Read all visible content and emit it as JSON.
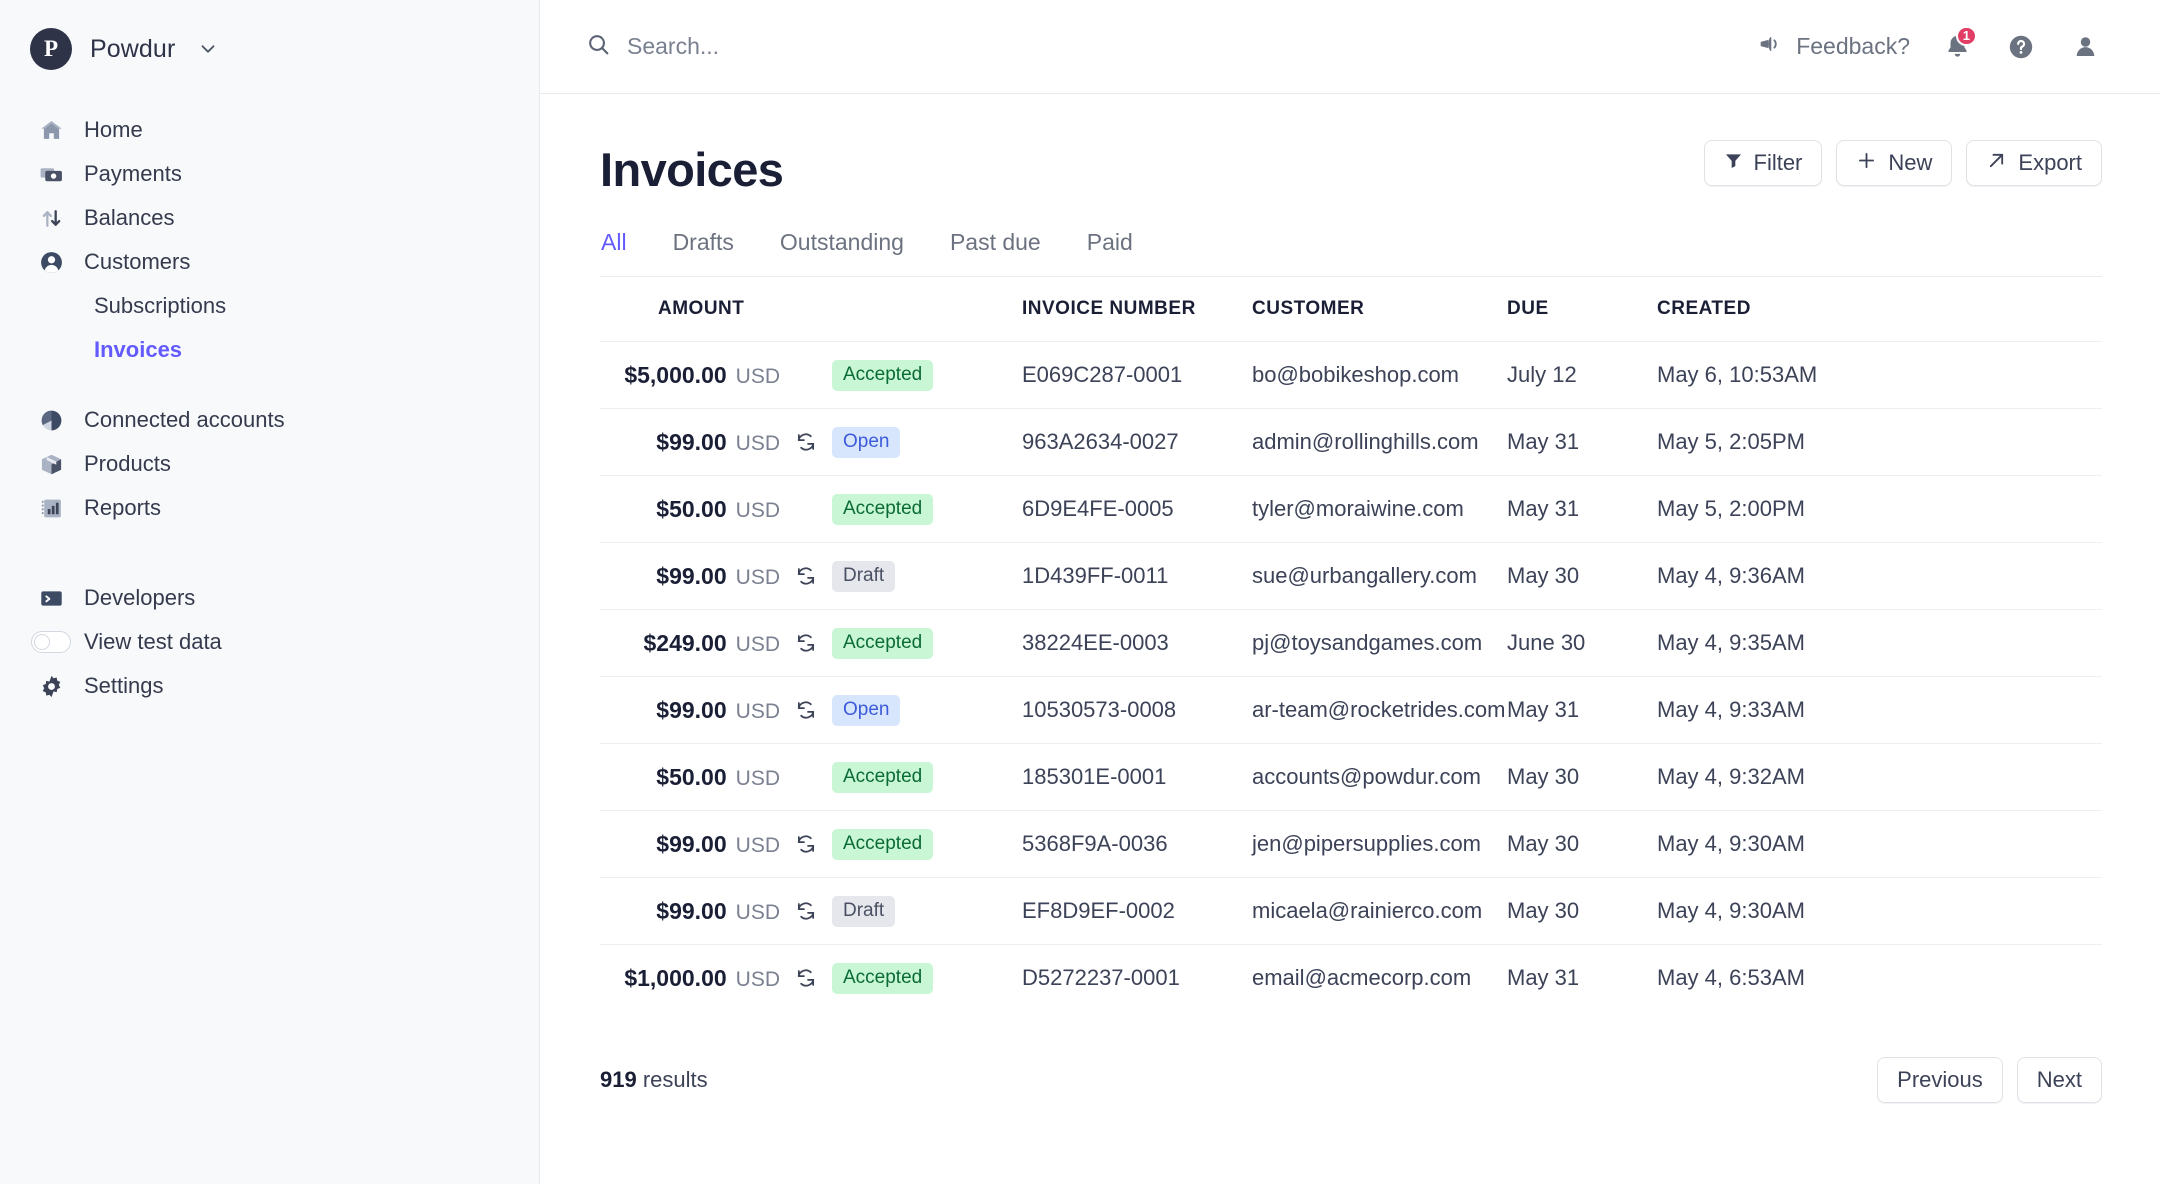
{
  "sidebar": {
    "brand": {
      "logo_letter": "P",
      "name": "Powdur",
      "caret_icon": "chevron-down-icon"
    },
    "items": [
      {
        "label": "Home",
        "icon": "home-icon",
        "active": false,
        "sub": false
      },
      {
        "label": "Payments",
        "icon": "payments-icon",
        "active": false,
        "sub": false
      },
      {
        "label": "Balances",
        "icon": "balances-icon",
        "active": false,
        "sub": false
      },
      {
        "label": "Customers",
        "icon": "customers-icon",
        "active": false,
        "sub": false
      },
      {
        "label": "Subscriptions",
        "icon": "",
        "active": false,
        "sub": true
      },
      {
        "label": "Invoices",
        "icon": "",
        "active": true,
        "sub": true
      },
      {
        "label": "Connected accounts",
        "icon": "connected-accounts-icon",
        "active": false,
        "sub": false
      },
      {
        "label": "Products",
        "icon": "products-icon",
        "active": false,
        "sub": false
      },
      {
        "label": "Reports",
        "icon": "reports-icon",
        "active": false,
        "sub": false
      }
    ],
    "footer_items": [
      {
        "label": "Developers",
        "icon": "terminal-icon"
      },
      {
        "label": "View test data",
        "icon": "toggle-off-icon"
      },
      {
        "label": "Settings",
        "icon": "gear-icon"
      }
    ]
  },
  "topbar": {
    "search": {
      "placeholder": "Search...",
      "icon": "search-icon",
      "value": ""
    },
    "feedback": {
      "label": "Feedback?",
      "icon": "megaphone-icon"
    },
    "notifications": {
      "icon": "bell-icon",
      "count": "1"
    },
    "help": {
      "icon": "help-circle-icon"
    },
    "account": {
      "icon": "user-avatar-icon"
    }
  },
  "page": {
    "title": "Invoices",
    "actions": [
      {
        "label": "Filter",
        "icon": "funnel-icon"
      },
      {
        "label": "New",
        "icon": "plus-icon"
      },
      {
        "label": "Export",
        "icon": "arrow-up-right-icon"
      }
    ],
    "tabs": [
      {
        "label": "All",
        "active": true
      },
      {
        "label": "Drafts",
        "active": false
      },
      {
        "label": "Outstanding",
        "active": false
      },
      {
        "label": "Past due",
        "active": false
      },
      {
        "label": "Paid",
        "active": false
      }
    ]
  },
  "table": {
    "columns": [
      "AMOUNT",
      "INVOICE NUMBER",
      "CUSTOMER",
      "DUE",
      "CREATED"
    ],
    "rows": [
      {
        "amount": "$5,000.00",
        "currency": "USD",
        "recurring": false,
        "status": "Accepted",
        "status_kind": "accepted",
        "invoice_number": "E069C287-0001",
        "customer": "bo@bobikeshop.com",
        "due": "July 12",
        "created": "May 6, 10:53AM"
      },
      {
        "amount": "$99.00",
        "currency": "USD",
        "recurring": true,
        "status": "Open",
        "status_kind": "open",
        "invoice_number": "963A2634-0027",
        "customer": "admin@rollinghills.com",
        "due": "May 31",
        "created": "May 5, 2:05PM"
      },
      {
        "amount": "$50.00",
        "currency": "USD",
        "recurring": false,
        "status": "Accepted",
        "status_kind": "accepted",
        "invoice_number": "6D9E4FE-0005",
        "customer": "tyler@moraiwine.com",
        "due": "May 31",
        "created": "May 5, 2:00PM"
      },
      {
        "amount": "$99.00",
        "currency": "USD",
        "recurring": true,
        "status": "Draft",
        "status_kind": "draft",
        "invoice_number": "1D439FF-0011",
        "customer": "sue@urbangallery.com",
        "due": "May 30",
        "created": "May 4, 9:36AM"
      },
      {
        "amount": "$249.00",
        "currency": "USD",
        "recurring": true,
        "status": "Accepted",
        "status_kind": "accepted",
        "invoice_number": "38224EE-0003",
        "customer": "pj@toysandgames.com",
        "due": "June 30",
        "created": "May 4, 9:35AM"
      },
      {
        "amount": "$99.00",
        "currency": "USD",
        "recurring": true,
        "status": "Open",
        "status_kind": "open",
        "invoice_number": "10530573-0008",
        "customer": "ar-team@rocketrides.com",
        "due": "May 31",
        "created": "May 4, 9:33AM"
      },
      {
        "amount": "$50.00",
        "currency": "USD",
        "recurring": false,
        "status": "Accepted",
        "status_kind": "accepted",
        "invoice_number": "185301E-0001",
        "customer": "accounts@powdur.com",
        "due": "May 30",
        "created": "May 4, 9:32AM"
      },
      {
        "amount": "$99.00",
        "currency": "USD",
        "recurring": true,
        "status": "Accepted",
        "status_kind": "accepted",
        "invoice_number": "5368F9A-0036",
        "customer": "jen@pipersupplies.com",
        "due": "May 30",
        "created": "May 4, 9:30AM"
      },
      {
        "amount": "$99.00",
        "currency": "USD",
        "recurring": true,
        "status": "Draft",
        "status_kind": "draft",
        "invoice_number": "EF8D9EF-0002",
        "customer": "micaela@rainierco.com",
        "due": "May 30",
        "created": "May 4, 9:30AM"
      },
      {
        "amount": "$1,000.00",
        "currency": "USD",
        "recurring": true,
        "status": "Accepted",
        "status_kind": "accepted",
        "invoice_number": "D5272237-0001",
        "customer": "email@acmecorp.com",
        "due": "May 31",
        "created": "May 4, 6:53AM"
      }
    ]
  },
  "footer": {
    "results_count": "919",
    "results_label": "results",
    "previous_label": "Previous",
    "next_label": "Next"
  },
  "colors": {
    "accent": "#635bff",
    "sidebar_bg": "#f7f9fb",
    "text_primary": "#1a1f36",
    "badge_red": "#e03e64",
    "accepted_bg": "#c9f7d6",
    "open_bg": "#d7e6fd",
    "draft_bg": "#e5e7ec"
  }
}
